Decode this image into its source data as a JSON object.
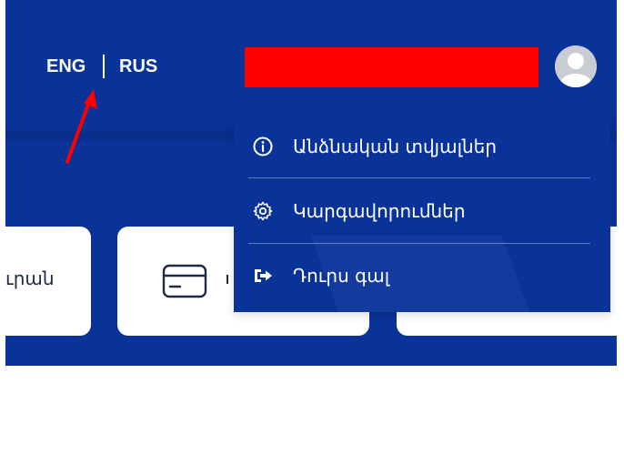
{
  "header": {
    "languages": [
      {
        "code": "ENG"
      },
      {
        "code": "RUS"
      }
    ],
    "user_name_redacted": ""
  },
  "cards": [
    {
      "label": "ւրան"
    },
    {
      "label": "",
      "icon": "card-icon"
    },
    {
      "label": ""
    }
  ],
  "user_menu": {
    "items": [
      {
        "label": "Անձնական տվյալներ",
        "icon": "info-icon"
      },
      {
        "label": "Կարգավորումներ",
        "icon": "gear-icon"
      },
      {
        "label": "Դուրս գալ",
        "icon": "logout-icon"
      }
    ]
  },
  "colors": {
    "primary_blue": "#0a3399",
    "redaction": "#ff0000",
    "annotation_arrow": "#ff0000",
    "card_bg": "#ffffff"
  }
}
